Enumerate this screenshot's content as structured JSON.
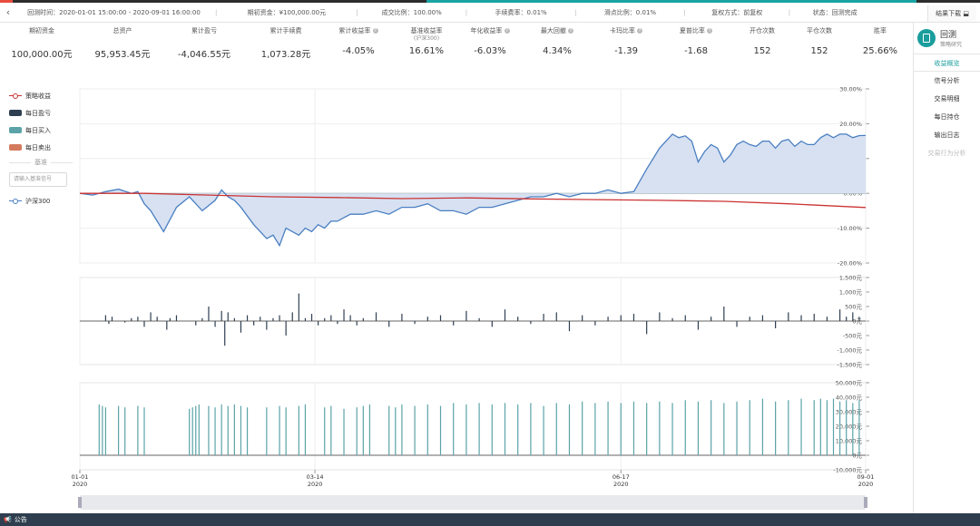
{
  "colors": {
    "accent": "#1a9d9d",
    "strategy": "#4a7fc1",
    "strategy_fill": "#d7e1f2",
    "benchmark": "#cc3333",
    "pnl": "#2f3f52",
    "buy": "#5ba3a8",
    "sell": "#d47a5e"
  },
  "infobar": {
    "back_icon": "chevron-left-icon",
    "items": [
      "回测时间：2020-01-01 15:00:00 - 2020-09-01 16:00:00",
      "期初资金：¥100,000.00元",
      "成交比例：100.00%",
      "手续费率：0.01%",
      "滑点比例：0.01%",
      "复权方式：前复权",
      "状态：回测完成"
    ],
    "download_label": "结果下载"
  },
  "metrics": [
    {
      "label": "期初资金",
      "sub": "",
      "value": "100,000.00元",
      "help": false
    },
    {
      "label": "总资产",
      "sub": "",
      "value": "95,953.45元",
      "help": false
    },
    {
      "label": "累计盈亏",
      "sub": "",
      "value": "-4,046.55元",
      "help": false
    },
    {
      "label": "累计手续费",
      "sub": "",
      "value": "1,073.28元",
      "help": false
    },
    {
      "label": "累计收益率",
      "sub": "",
      "value": "-4.05%",
      "help": true
    },
    {
      "label": "基准收益率",
      "sub": "(沪深300)",
      "value": "16.61%",
      "help": false
    },
    {
      "label": "年化收益率",
      "sub": "",
      "value": "-6.03%",
      "help": true
    },
    {
      "label": "最大回撤",
      "sub": "",
      "value": "4.34%",
      "help": true
    },
    {
      "label": "卡玛比率",
      "sub": "",
      "value": "-1.39",
      "help": true
    },
    {
      "label": "夏普比率",
      "sub": "",
      "value": "-1.68",
      "help": true
    },
    {
      "label": "开仓次数",
      "sub": "",
      "value": "152",
      "help": false
    },
    {
      "label": "平仓次数",
      "sub": "",
      "value": "152",
      "help": false
    },
    {
      "label": "胜率",
      "sub": "",
      "value": "25.66%",
      "help": false
    }
  ],
  "rightnav": {
    "title": "回测",
    "subtitle": "策略研究",
    "items": [
      {
        "label": "收益概览",
        "active": true,
        "disabled": false
      },
      {
        "label": "信号分析",
        "active": false,
        "disabled": false
      },
      {
        "label": "交易明细",
        "active": false,
        "disabled": false
      },
      {
        "label": "每日持仓",
        "active": false,
        "disabled": false
      },
      {
        "label": "输出日志",
        "active": false,
        "disabled": false
      },
      {
        "label": "交易行为分析",
        "active": false,
        "disabled": true
      }
    ]
  },
  "legend": {
    "strategy": "策略收益",
    "pnl": "每日盈亏",
    "buy": "每日买入",
    "sell": "每日卖出",
    "benchmark_divider": "基准",
    "benchmark_input_placeholder": "请输入基准信号",
    "benchmark_series": "沪深300"
  },
  "footer": {
    "label": "公告",
    "icon": "megaphone-icon"
  },
  "chart_data": [
    {
      "type": "line",
      "yunit": "percent",
      "ylim": [
        -20,
        30
      ],
      "yticks": [
        "30.00%",
        "20.00%",
        "10.00%",
        "0.00%",
        "-10.00%",
        "-20.00%"
      ],
      "grid": true,
      "series": [
        {
          "name": "沪深300",
          "style": "area",
          "x": [
            0,
            4,
            8,
            12,
            16,
            18,
            20,
            22,
            24,
            26,
            30,
            34,
            38,
            42,
            44,
            46,
            48,
            50,
            54,
            58,
            60,
            62,
            64,
            66,
            68,
            70,
            72,
            74,
            76,
            78,
            80,
            84,
            88,
            92,
            96,
            100,
            104,
            108,
            112,
            116,
            120,
            124,
            128,
            132,
            136,
            140,
            144,
            148,
            152,
            156,
            160,
            164,
            168,
            172,
            176,
            180,
            184,
            186,
            188,
            190,
            192,
            194,
            196,
            198,
            200,
            202,
            204,
            206,
            208,
            210,
            212,
            214,
            216,
            218,
            220,
            222,
            224,
            226,
            228,
            230,
            232,
            234,
            236,
            238,
            240,
            242,
            244
          ],
          "y": [
            0,
            -0.5,
            0.5,
            1.2,
            0,
            0.5,
            -3,
            -5,
            -8,
            -11,
            -4,
            -1,
            -5,
            -2,
            1,
            -1,
            -2,
            -4,
            -9,
            -13,
            -12,
            -15,
            -10,
            -11,
            -12,
            -10,
            -11,
            -9,
            -10,
            -8,
            -8,
            -6,
            -6,
            -5,
            -6,
            -4,
            -4,
            -3,
            -5,
            -5,
            -6,
            -4,
            -4,
            -3,
            -2,
            -1,
            -1,
            0,
            -1,
            0,
            0,
            1,
            0,
            0.5,
            7,
            13,
            17,
            16,
            16.5,
            15,
            9,
            12,
            14,
            13,
            9,
            11,
            14,
            15,
            14,
            13.5,
            15,
            15,
            13,
            15,
            15.5,
            13.5,
            15,
            14,
            14,
            16,
            17,
            16,
            17,
            17,
            16,
            16.6,
            16.61
          ]
        },
        {
          "name": "策略收益",
          "style": "line",
          "x": [
            0,
            20,
            40,
            60,
            80,
            100,
            120,
            140,
            160,
            180,
            200,
            220,
            244
          ],
          "y": [
            0,
            0,
            -0.5,
            -1,
            -1.2,
            -1.5,
            -1.3,
            -1.6,
            -1.8,
            -2,
            -2.3,
            -3,
            -4.05
          ]
        }
      ]
    },
    {
      "type": "bar",
      "yunit": "yuan",
      "ylim": [
        -1500,
        1500
      ],
      "yticks": [
        "1,500元",
        "1,000元",
        "500元",
        "0元",
        "-500元",
        "-1,000元",
        "-1,500元"
      ],
      "series": [
        {
          "name": "每日盈亏",
          "x": [
            8,
            9,
            10,
            14,
            16,
            18,
            20,
            22,
            24,
            27,
            28,
            30,
            36,
            38,
            40,
            42,
            44,
            45,
            46,
            48,
            50,
            52,
            54,
            56,
            58,
            60,
            62,
            64,
            66,
            68,
            70,
            72,
            74,
            76,
            78,
            80,
            82,
            84,
            86,
            88,
            92,
            96,
            100,
            104,
            108,
            112,
            116,
            120,
            124,
            128,
            132,
            136,
            140,
            144,
            148,
            152,
            156,
            160,
            164,
            168,
            172,
            176,
            180,
            184,
            188,
            192,
            196,
            200,
            204,
            208,
            212,
            216,
            220,
            224,
            228,
            232,
            236,
            238,
            240,
            242
          ],
          "values": [
            200,
            -100,
            150,
            -50,
            100,
            150,
            -200,
            300,
            150,
            -300,
            100,
            200,
            -150,
            100,
            500,
            -200,
            350,
            -850,
            300,
            100,
            -400,
            200,
            -150,
            150,
            -300,
            100,
            200,
            -500,
            300,
            950,
            100,
            250,
            -150,
            100,
            200,
            -100,
            400,
            200,
            -150,
            100,
            300,
            -200,
            250,
            -100,
            150,
            200,
            -150,
            350,
            100,
            -200,
            400,
            150,
            -100,
            250,
            300,
            -350,
            200,
            -150,
            150,
            200,
            250,
            -450,
            300,
            100,
            200,
            -300,
            150,
            500,
            -200,
            150,
            200,
            -250,
            300,
            200,
            250,
            150,
            400,
            150,
            300,
            150
          ]
        }
      ]
    },
    {
      "type": "bar",
      "yunit": "yuan",
      "ylim": [
        -10000,
        50000
      ],
      "yticks": [
        "50,000元",
        "40,000元",
        "30,000元",
        "20,000元",
        "10,000元",
        "0元",
        "-10,000元"
      ],
      "series": [
        {
          "name": "每日买入",
          "x": [
            6,
            7,
            8,
            12,
            14,
            18,
            20,
            34,
            35,
            36,
            37,
            40,
            42,
            44,
            46,
            48,
            50,
            52,
            58,
            62,
            64,
            68,
            70,
            76,
            78,
            82,
            86,
            88,
            90,
            96,
            98,
            100,
            104,
            108,
            112,
            116,
            120,
            124,
            128,
            132,
            136,
            140,
            144,
            148,
            152,
            156,
            160,
            164,
            168,
            172,
            176,
            180,
            184,
            188,
            192,
            196,
            200,
            204,
            208,
            212,
            216,
            220,
            224,
            228,
            230,
            232,
            234,
            236,
            238,
            240,
            242
          ],
          "values": [
            35000,
            34000,
            33000,
            34000,
            33000,
            34000,
            33000,
            32000,
            33000,
            34000,
            35000,
            34000,
            33000,
            35000,
            34000,
            35000,
            34000,
            33000,
            33000,
            34000,
            33000,
            34000,
            35000,
            33000,
            34000,
            32000,
            33000,
            34000,
            35000,
            34000,
            33000,
            35000,
            34000,
            35000,
            34000,
            36000,
            35000,
            36000,
            35000,
            36000,
            35000,
            36000,
            34000,
            36000,
            35000,
            37000,
            36000,
            37000,
            36000,
            37000,
            36000,
            37000,
            36000,
            38000,
            37000,
            38000,
            36000,
            37000,
            38000,
            39000,
            37000,
            38000,
            39000,
            38000,
            39000,
            38000,
            39000,
            37000,
            38000,
            36000,
            38000
          ]
        }
      ]
    }
  ],
  "xaxis": {
    "days": 244,
    "ticks": [
      {
        "day": 0,
        "label": "01-01",
        "year": "2020"
      },
      {
        "day": 73,
        "label": "03-14",
        "year": "2020"
      },
      {
        "day": 168,
        "label": "06-17",
        "year": "2020"
      },
      {
        "day": 244,
        "label": "09-01",
        "year": "2020"
      }
    ]
  }
}
